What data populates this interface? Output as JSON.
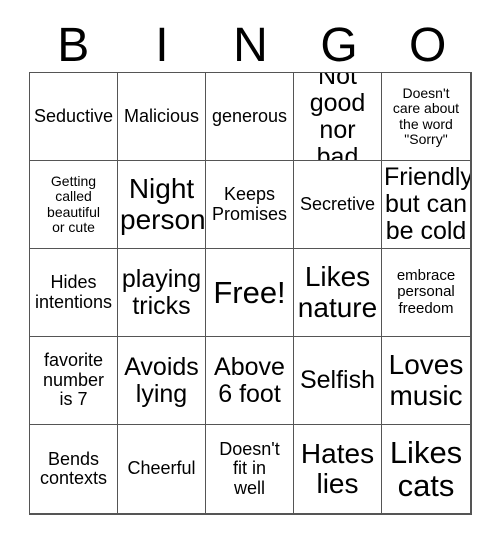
{
  "card": {
    "title": "BINGO",
    "header_letters": [
      "B",
      "I",
      "N",
      "G",
      "O"
    ],
    "free_space_index": 12,
    "colors": {
      "background": "#ffffff",
      "text": "#000000",
      "grid_line": "#555555"
    },
    "grid": {
      "columns": 5,
      "rows": 5
    },
    "cells": [
      {
        "text": "Seductive",
        "size": "fs-sm",
        "lines": 1,
        "free": false
      },
      {
        "text": "Malicious",
        "size": "fs-sm",
        "lines": 1,
        "free": false
      },
      {
        "text": "generous",
        "size": "fs-sm",
        "lines": 1,
        "free": false
      },
      {
        "text": "Not\ngood\nnor bad",
        "size": "fs-md",
        "lines": 3,
        "free": false
      },
      {
        "text": "Doesn't\ncare about\nthe word\n\"Sorry\"",
        "size": "fs-xxs",
        "lines": 4,
        "free": false
      },
      {
        "text": "Getting\ncalled\nbeautiful\nor cute",
        "size": "fs-xxs",
        "lines": 4,
        "free": false
      },
      {
        "text": "Night\nperson",
        "size": "fs-lg",
        "lines": 2,
        "free": false
      },
      {
        "text": "Keeps\nPromises",
        "size": "fs-sm",
        "lines": 2,
        "free": false
      },
      {
        "text": "Secretive",
        "size": "fs-sm",
        "lines": 1,
        "free": false
      },
      {
        "text": "Friendly\nbut can\nbe cold",
        "size": "fs-md",
        "lines": 3,
        "free": false
      },
      {
        "text": "Hides\nintentions",
        "size": "fs-sm",
        "lines": 2,
        "free": false
      },
      {
        "text": "playing\ntricks",
        "size": "fs-md",
        "lines": 2,
        "free": false
      },
      {
        "text": "Free!",
        "size": "fs-xl",
        "lines": 1,
        "free": true
      },
      {
        "text": "Likes\nnature",
        "size": "fs-lg",
        "lines": 2,
        "free": false
      },
      {
        "text": "embrace\npersonal\nfreedom",
        "size": "fs-xs",
        "lines": 3,
        "free": false
      },
      {
        "text": "favorite\nnumber\nis 7",
        "size": "fs-sm",
        "lines": 3,
        "free": false
      },
      {
        "text": "Avoids\nlying",
        "size": "fs-md",
        "lines": 2,
        "free": false
      },
      {
        "text": "Above\n6 foot",
        "size": "fs-md",
        "lines": 2,
        "free": false
      },
      {
        "text": "Selfish",
        "size": "fs-md",
        "lines": 1,
        "free": false
      },
      {
        "text": "Loves\nmusic",
        "size": "fs-lg",
        "lines": 2,
        "free": false
      },
      {
        "text": "Bends\ncontexts",
        "size": "fs-sm",
        "lines": 2,
        "free": false
      },
      {
        "text": "Cheerful",
        "size": "fs-sm",
        "lines": 1,
        "free": false
      },
      {
        "text": "Doesn't\nfit in\nwell",
        "size": "fs-sm",
        "lines": 3,
        "free": false
      },
      {
        "text": "Hates\nlies",
        "size": "fs-lg",
        "lines": 2,
        "free": false
      },
      {
        "text": "Likes\ncats",
        "size": "fs-xl",
        "lines": 2,
        "free": false
      }
    ]
  }
}
